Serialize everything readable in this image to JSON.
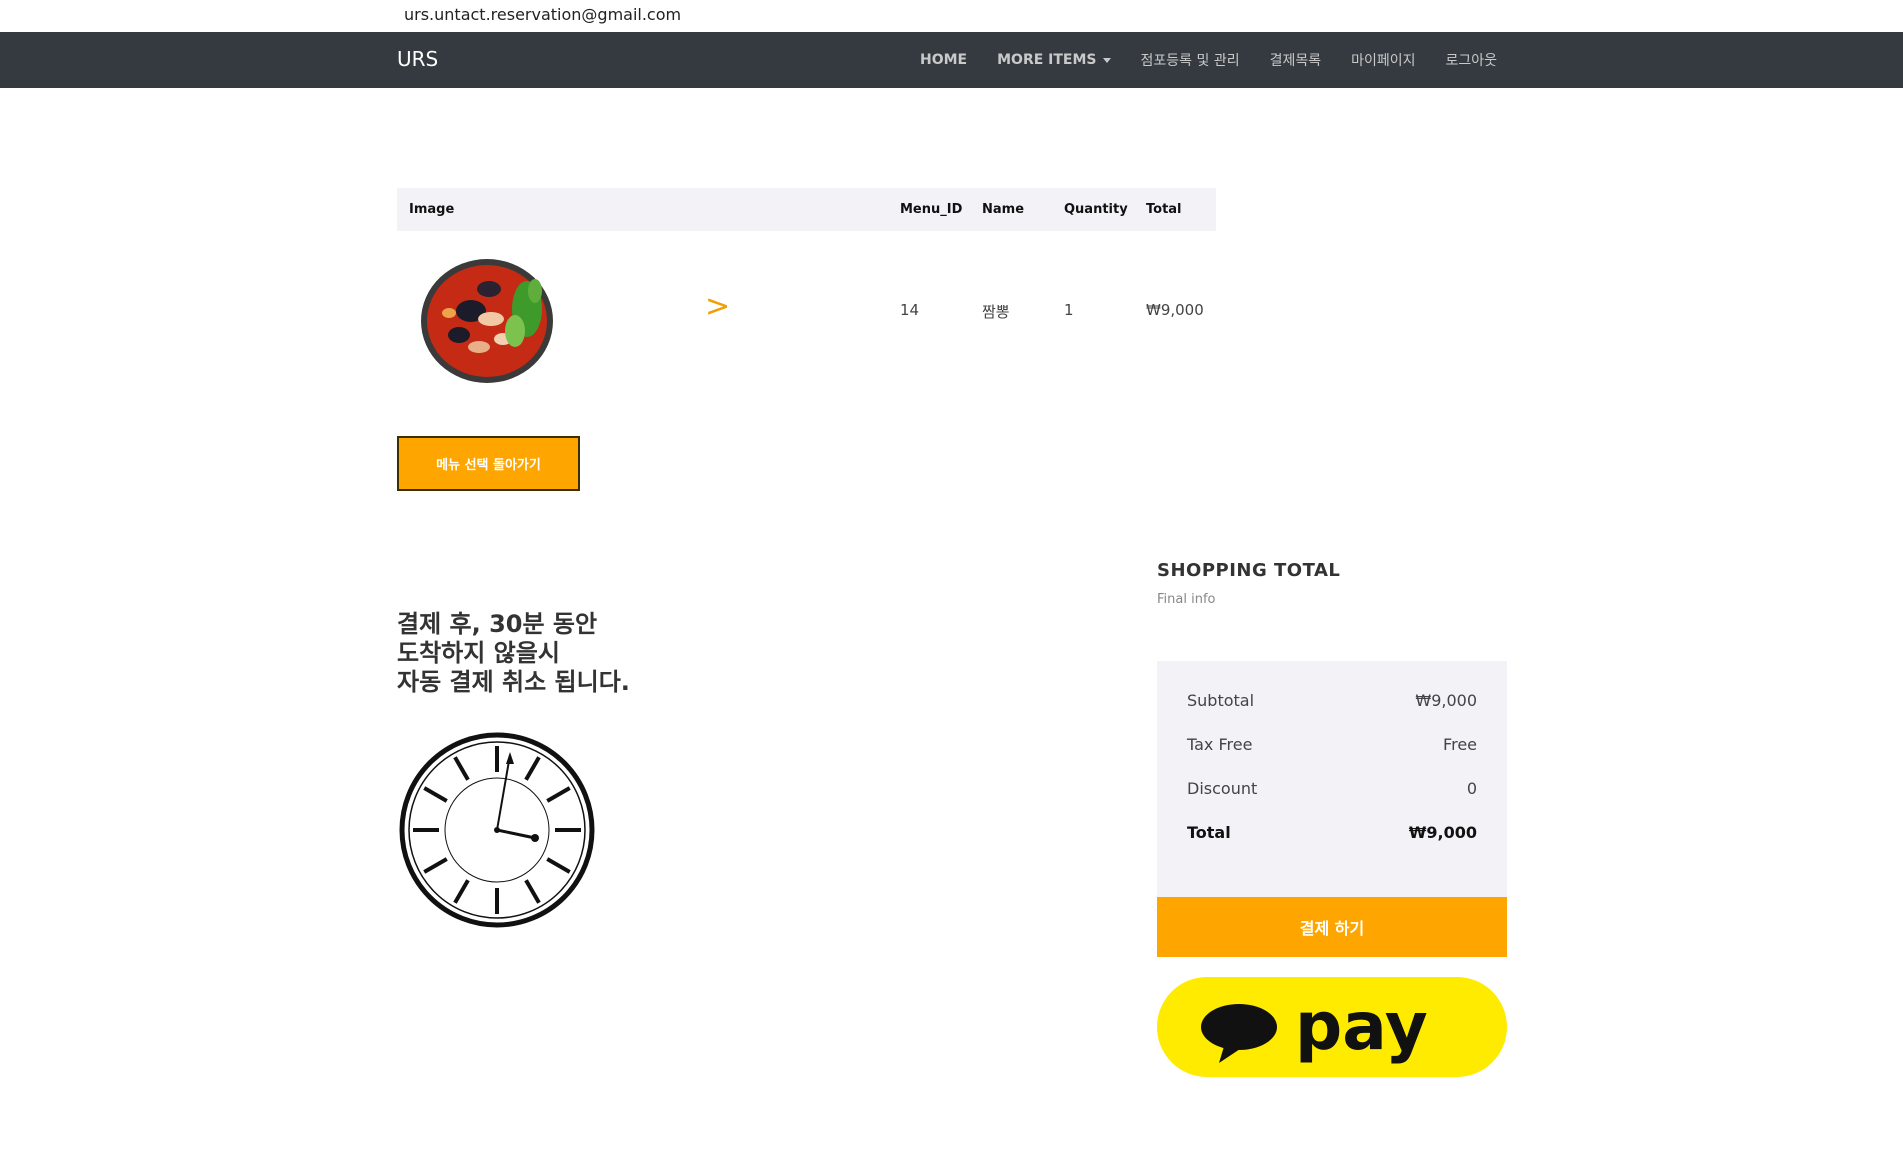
{
  "header": {
    "email": "urs.untact.reservation@gmail.com"
  },
  "navbar": {
    "brand": "URS",
    "items": [
      {
        "label": "HOME"
      },
      {
        "label": "MORE ITEMS"
      },
      {
        "label": "점포등록 및 관리"
      },
      {
        "label": "결제목록"
      },
      {
        "label": "마이페이지"
      },
      {
        "label": "로그아웃"
      }
    ]
  },
  "cart": {
    "headers": {
      "image": "Image",
      "menu_id": "Menu_ID",
      "name": "Name",
      "quantity": "Quantity",
      "total": "Total"
    },
    "rows": [
      {
        "arrow": ">",
        "menu_id": "14",
        "name": "짬뽕",
        "quantity": "1",
        "total": "₩9,000"
      }
    ]
  },
  "back_button": "메뉴 선택 돌아가기",
  "notice": {
    "line1": "결제 후, 30분 동안",
    "line2": "도착하지 않을시",
    "line3": "자동 결제 취소 됩니다."
  },
  "summary": {
    "title": "SHOPPING TOTAL",
    "subtitle": "Final info",
    "rows": [
      {
        "label": "Subtotal",
        "value": "₩9,000"
      },
      {
        "label": "Tax Free",
        "value": "Free"
      },
      {
        "label": "Discount",
        "value": "0"
      },
      {
        "label": "Total",
        "value": "₩9,000"
      }
    ],
    "pay_button": "결제 하기",
    "kakao_label": "pay"
  },
  "colors": {
    "navbar": "#343a40",
    "accent": "#ffa500",
    "kakao": "#ffeb00",
    "panel": "#f3f2f7"
  }
}
